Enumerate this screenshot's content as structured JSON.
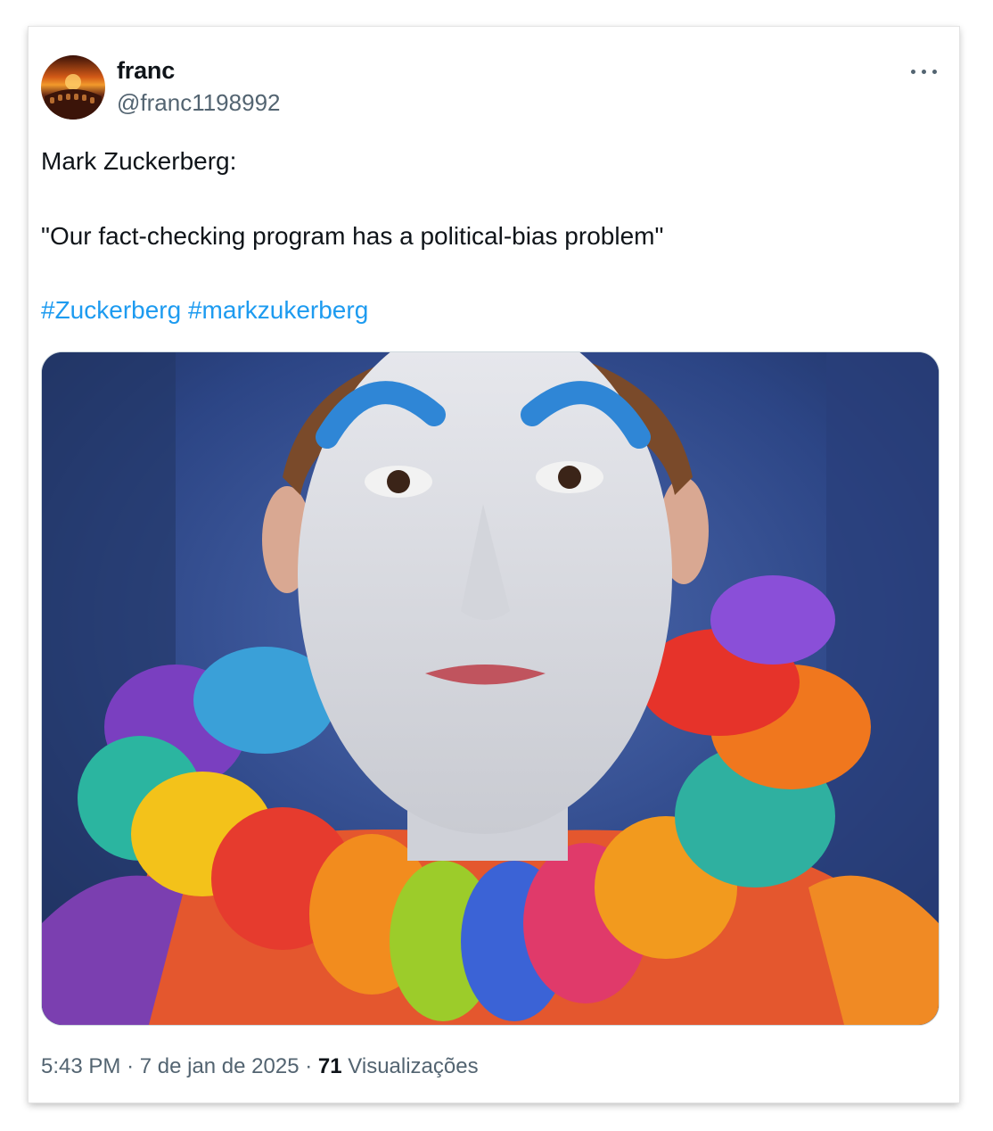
{
  "post": {
    "display_name": "franc",
    "handle": "@franc1198992",
    "avatar_icon": "colosseum-sunset-avatar",
    "more_icon": "more-options-icon",
    "text_line1": "Mark Zuckerberg:",
    "text_line2": "\"Our fact-checking program has a political-bias problem\"",
    "hashtags": [
      "#Zuckerberg",
      "#markzukerberg"
    ],
    "time": "5:43 PM",
    "separator": "·",
    "date": "7 de jan de 2025",
    "views_count": "71",
    "views_label": "Visualizações"
  },
  "colors": {
    "text": "#0f1419",
    "secondary": "#536471",
    "link": "#1d9bf0"
  }
}
